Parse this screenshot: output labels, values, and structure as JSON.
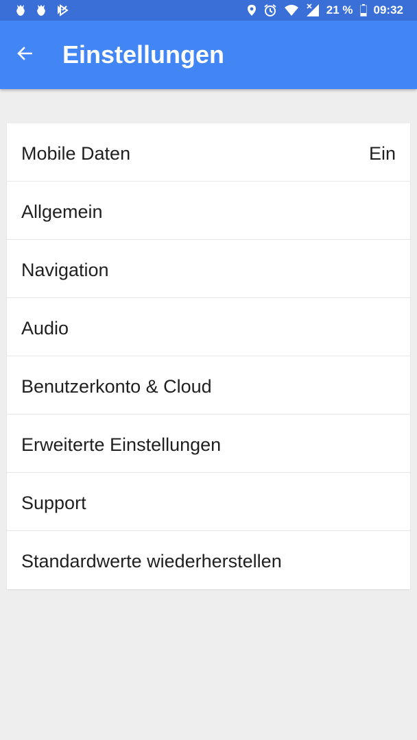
{
  "status_bar": {
    "battery_text": "21 %",
    "time": "09:32",
    "left_icons": [
      "notification-icon",
      "notification-icon",
      "app-notification-icon"
    ],
    "right_icons": [
      "location-icon",
      "alarm-icon",
      "wifi-icon",
      "signal-icon",
      "battery-icon"
    ]
  },
  "app_bar": {
    "title": "Einstellungen",
    "back_icon": "arrow-back-icon",
    "color": "#4285f4"
  },
  "settings": {
    "items": [
      {
        "label": "Mobile Daten",
        "value": "Ein"
      },
      {
        "label": "Allgemein"
      },
      {
        "label": "Navigation"
      },
      {
        "label": "Audio"
      },
      {
        "label": "Benutzerkonto & Cloud"
      },
      {
        "label": "Erweiterte Einstellungen"
      },
      {
        "label": "Support"
      },
      {
        "label": "Standardwerte wiederherstellen"
      }
    ]
  }
}
